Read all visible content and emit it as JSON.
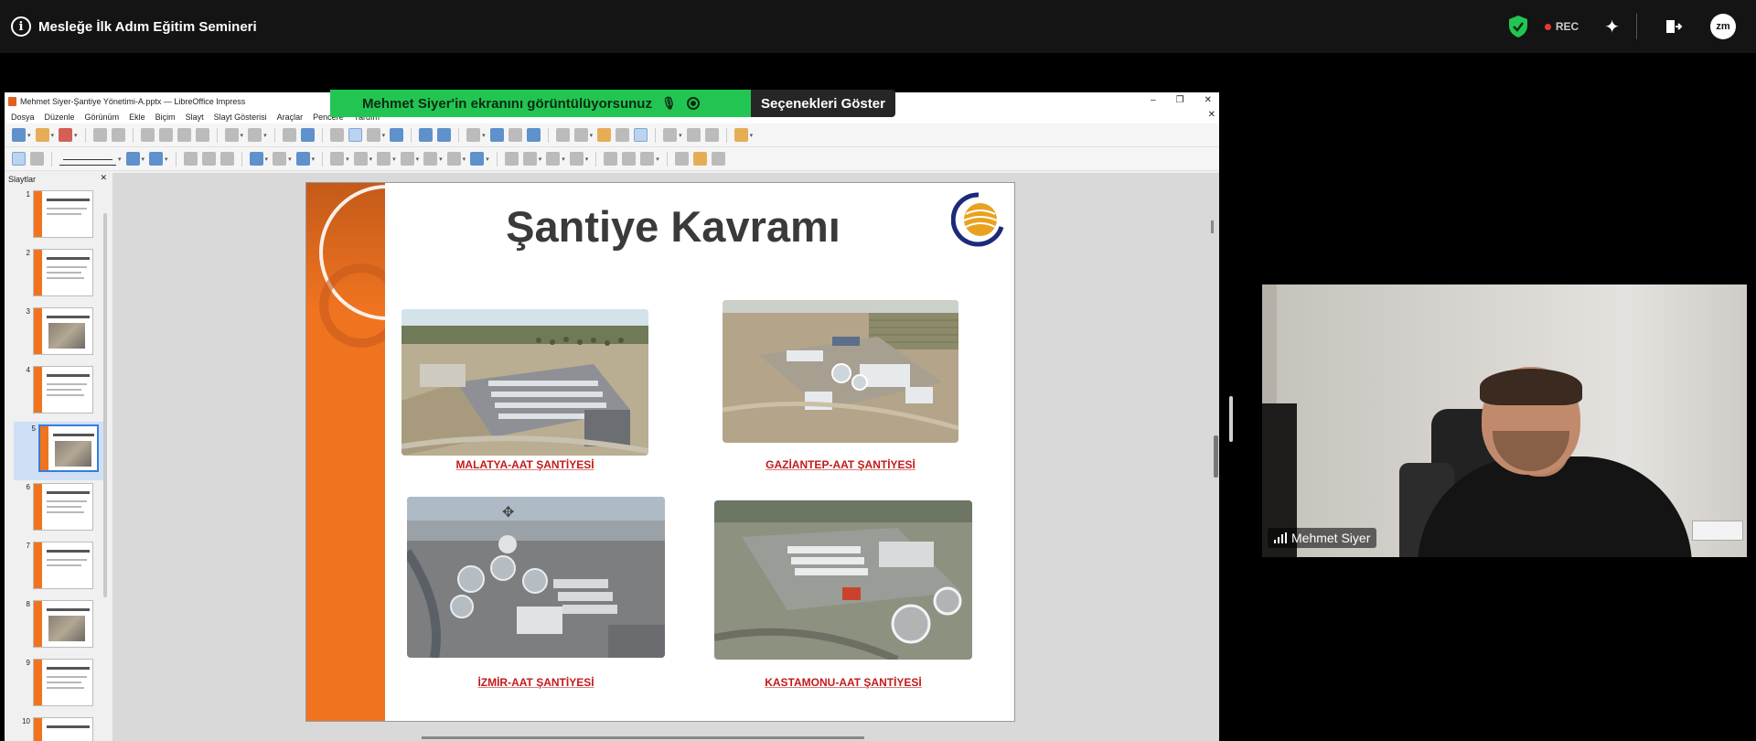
{
  "zoom": {
    "meeting_title": "Mesleğe İlk Adım Eğitim Semineri",
    "rec_label": "REC",
    "avatar_initials": "zm",
    "share_banner": "Mehmet Siyer'in ekranını görüntülüyorsunuz",
    "options_label": "Seçenekleri Göster",
    "participant_name": "Mehmet Siyer"
  },
  "libreoffice": {
    "window_title": "Mehmet Siyer-Şantiye Yönetimi-A.pptx — LibreOffice Impress",
    "menu": [
      "Dosya",
      "Düzenle",
      "Görünüm",
      "Ekle",
      "Biçim",
      "Slayt",
      "Slayt Gösterisi",
      "Araçlar",
      "Pencere",
      "Yardım"
    ],
    "slides_pane_title": "Slaytlar",
    "slide_numbers": [
      "1",
      "2",
      "3",
      "4",
      "5",
      "6",
      "7",
      "8",
      "9",
      "10"
    ],
    "selected_slide": 5
  },
  "slide": {
    "title": "Şantiye Kavramı",
    "captions": [
      "MALATYA-AAT ŞANTİYESİ",
      "GAZİANTEP-AAT ŞANTİYESİ",
      "İZMİR-AAT ŞANTİYESİ",
      "KASTAMONU-AAT ŞANTİYESİ"
    ]
  },
  "colors": {
    "accent_orange": "#f07420",
    "banner_green": "#23c552",
    "caption_red": "#c41a1a"
  }
}
